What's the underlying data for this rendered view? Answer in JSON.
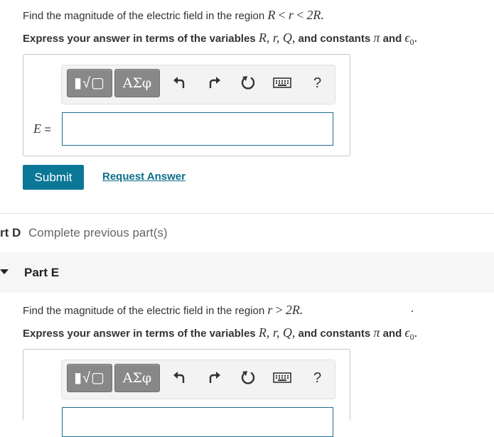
{
  "part_c": {
    "question_prefix": "Find the magnitude of the electric field in the region",
    "region": [
      "R",
      "<",
      "r",
      "<",
      "2R."
    ],
    "express_prefix": "Express your answer in terms of the variables",
    "variables": [
      "R",
      ", r",
      ", Q",
      ","
    ],
    "and_constants": "and constants",
    "pi": "π",
    "and": "and",
    "epsilon": "ϵ",
    "sub0": "0",
    "period": ".",
    "label_var": "E",
    "label_eq": " =",
    "input_value": "",
    "submit_label": "Submit",
    "request_label": "Request Answer"
  },
  "toolbar": {
    "templates_label": "▮√▢",
    "symbols_label": "ΑΣφ",
    "help_label": "?"
  },
  "part_d": {
    "title": "rt D",
    "status": "Complete previous part(s)"
  },
  "part_e": {
    "title": "Part E",
    "question_prefix": "Find the magnitude of the electric field in the region",
    "region": [
      "r",
      ">",
      "2R."
    ],
    "express_prefix": "Express your answer in terms of the variables",
    "variables": [
      "R",
      ", r",
      ", Q",
      ","
    ],
    "and_constants": "and constants",
    "pi": "π",
    "and": "and",
    "epsilon": "ϵ",
    "sub0": "0",
    "period": "."
  },
  "colors": {
    "accent": "#0b7796",
    "field_border": "#1c6f90",
    "panel_bg": "#f6f6f6"
  }
}
